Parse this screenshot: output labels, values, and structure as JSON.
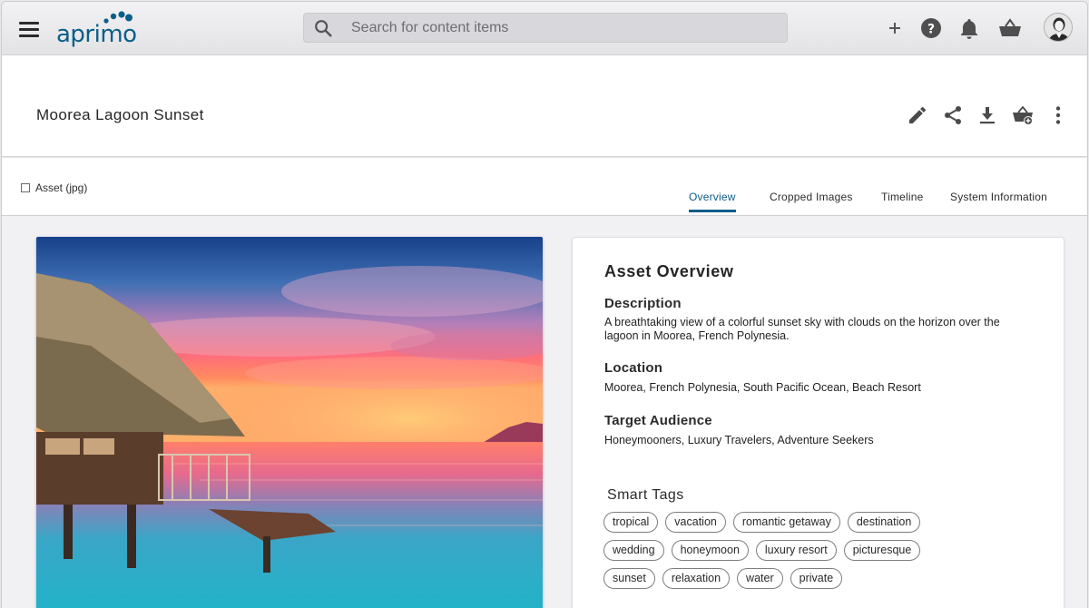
{
  "app": {
    "brand": "aprimo",
    "accent_color": "#0b5e8a"
  },
  "header": {
    "search_placeholder": "Search for content items",
    "icons": [
      "menu-icon",
      "search-icon",
      "plus-icon",
      "help-icon",
      "bell-icon",
      "basket-icon",
      "avatar"
    ]
  },
  "asset": {
    "title": "Moorea Lagoon Sunset",
    "type_label": "Asset (jpg)",
    "actions": [
      "edit-icon",
      "share-icon",
      "download-icon",
      "add-to-basket-icon",
      "more-vert-icon"
    ]
  },
  "tabs": [
    {
      "label": "Overview",
      "active": true
    },
    {
      "label": "Cropped Images",
      "active": false
    },
    {
      "label": "Timeline",
      "active": false
    },
    {
      "label": "System Information",
      "active": false
    }
  ],
  "overview": {
    "title": "Asset Overview",
    "description_label": "Description",
    "description": "A breathtaking view of a colorful sunset sky with clouds on the horizon over the lagoon in Moorea, French Polynesia.",
    "location_label": "Location",
    "location": "Moorea, French Polynesia, South Pacific Ocean, Beach Resort",
    "audience_label": "Target Audience",
    "audience": "Honeymooners, Luxury Travelers, Adventure Seekers",
    "smart_tags_label": "Smart Tags",
    "tag_rows": [
      [
        "tropical",
        "vacation",
        "romantic getaway",
        "destination"
      ],
      [
        "wedding",
        "honeymoon",
        "luxury resort",
        "picturesque"
      ],
      [
        "sunset",
        "relaxation",
        "water",
        "private"
      ]
    ]
  }
}
